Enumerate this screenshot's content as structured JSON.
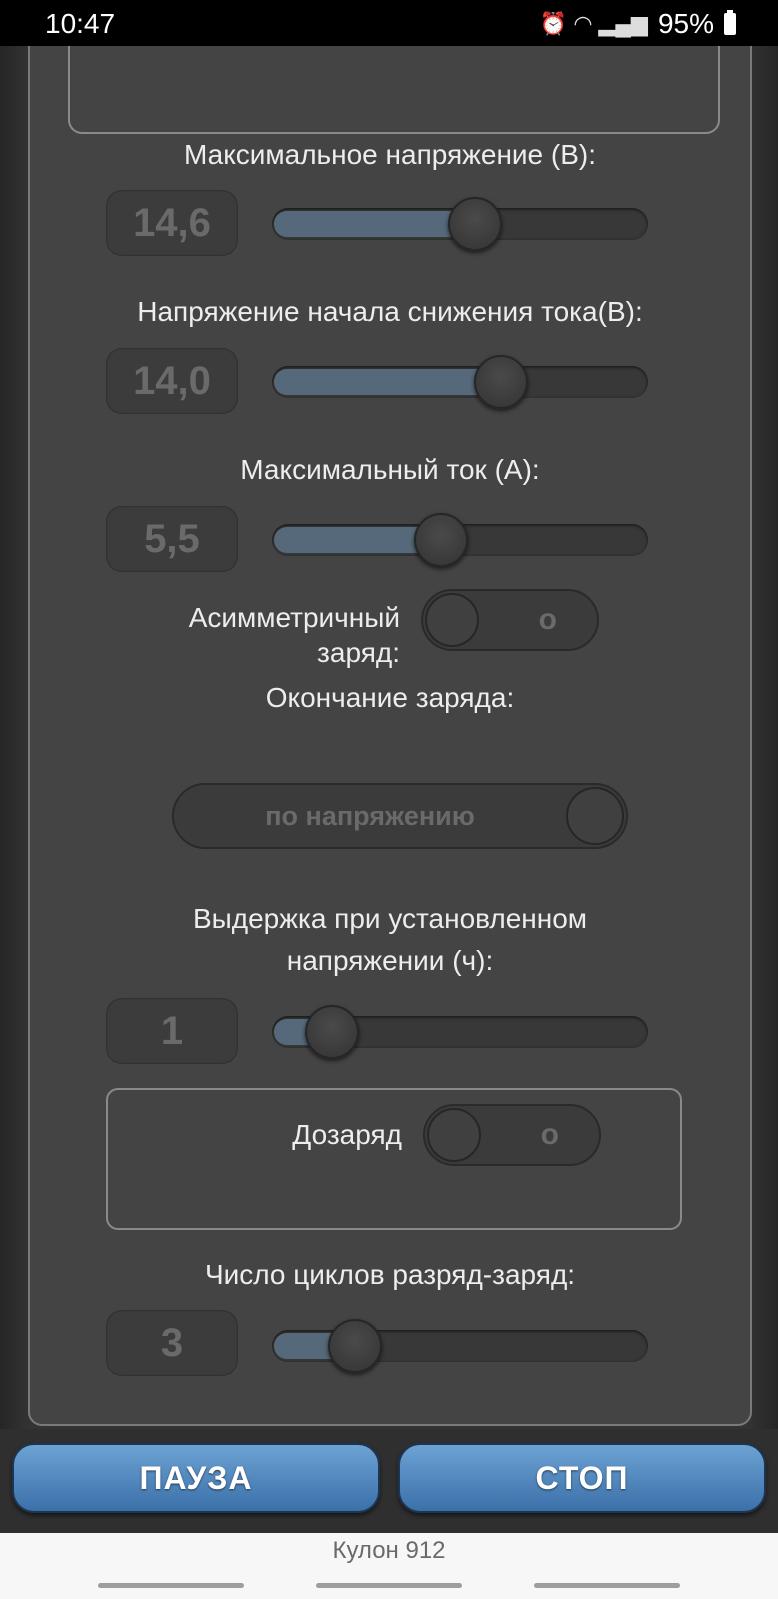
{
  "status_bar": {
    "time": "10:47",
    "battery": "95%",
    "icons": [
      "alarm-icon",
      "wifi-icon",
      "signal-icon",
      "battery-icon"
    ]
  },
  "settings": {
    "max_voltage": {
      "label": "Максимальное напряжение (В):",
      "value": "14,6",
      "slider_fraction": 0.54
    },
    "decline_voltage": {
      "label": "Напряжение начала снижения тока(В):",
      "value": "14,0",
      "slider_fraction": 0.61
    },
    "max_current": {
      "label": "Максимальный ток (А):",
      "value": "5,5",
      "slider_fraction": 0.45
    },
    "asymmetric": {
      "label_line1": "Асимметричный",
      "label_line2": "заряд:",
      "state": "o"
    },
    "charge_end": {
      "label": "Окончание заряда:",
      "selected": "по напряжению"
    },
    "hold": {
      "label_line1": "Выдержка при установленном",
      "label_line2": "напряжении (ч):",
      "value": "1",
      "slider_fraction": 0.16
    },
    "recharge": {
      "label": "Дозаряд",
      "state": "o"
    },
    "cycles": {
      "label": "Число циклов разряд-заряд:",
      "value": "3",
      "slider_fraction": 0.22
    }
  },
  "buttons": {
    "pause": "ПАУЗА",
    "stop": "СТОП"
  },
  "app_title": "Кулон 912",
  "colors": {
    "accent": "#4a85c0",
    "panel": "#444444"
  }
}
